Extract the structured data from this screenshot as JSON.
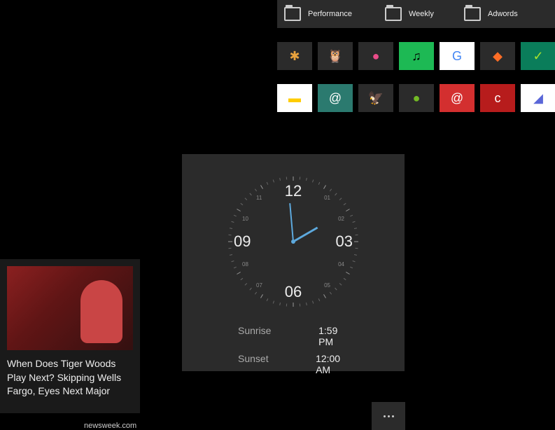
{
  "folders": [
    "Performance",
    "Weekly",
    "Adwords"
  ],
  "apps_row1": [
    {
      "name": "slack",
      "bg": "#2b2b2b",
      "glyph": "✱",
      "color": "#e8a23d"
    },
    {
      "name": "duolingo",
      "bg": "#2b2b2b",
      "glyph": "🦉",
      "color": "#7cc043"
    },
    {
      "name": "dribbble",
      "bg": "#2b2b2b",
      "glyph": "●",
      "color": "#ea4c89"
    },
    {
      "name": "spotify",
      "bg": "#1db954",
      "glyph": "♫",
      "color": "#000"
    },
    {
      "name": "translate",
      "bg": "#fff",
      "glyph": "G",
      "color": "#4285f4"
    },
    {
      "name": "gitlab",
      "bg": "#2b2b2b",
      "glyph": "◆",
      "color": "#fc6d26"
    },
    {
      "name": "ca",
      "bg": "#0a7d5a",
      "glyph": "✓",
      "color": "#a6e22e"
    }
  ],
  "apps_row2": [
    {
      "name": "notes",
      "bg": "#fff",
      "glyph": "▬",
      "color": "#ffcc00"
    },
    {
      "name": "mail",
      "bg": "#2b7a6f",
      "glyph": "@",
      "color": "#fff"
    },
    {
      "name": "barclays",
      "bg": "#2b2b2b",
      "glyph": "🦅",
      "color": "#00aeef"
    },
    {
      "name": "openSUSE",
      "bg": "#2b2b2b",
      "glyph": "●",
      "color": "#73ba25"
    },
    {
      "name": "mail2",
      "bg": "#d32f2f",
      "glyph": "@",
      "color": "#fff"
    },
    {
      "name": "cnet",
      "bg": "#b71c1c",
      "glyph": "c",
      "color": "#fff"
    },
    {
      "name": "baremetrics",
      "bg": "#fff",
      "glyph": "◢",
      "color": "#5a67d8"
    }
  ],
  "clock": {
    "n12": "12",
    "n03": "03",
    "n06": "06",
    "n09": "09",
    "s01": "01",
    "s02": "02",
    "s04": "04",
    "s05": "05",
    "s07": "07",
    "s08": "08",
    "s10": "10",
    "s11": "11",
    "sunrise_label": "Sunrise",
    "sunrise_val": "1:59 PM",
    "sunset_label": "Sunset",
    "sunset_val": "12:00 AM"
  },
  "news": {
    "title": "When Does Tiger Woods Play Next? Skipping Wells Fargo, Eyes Next Major",
    "source": "newsweek.com"
  }
}
